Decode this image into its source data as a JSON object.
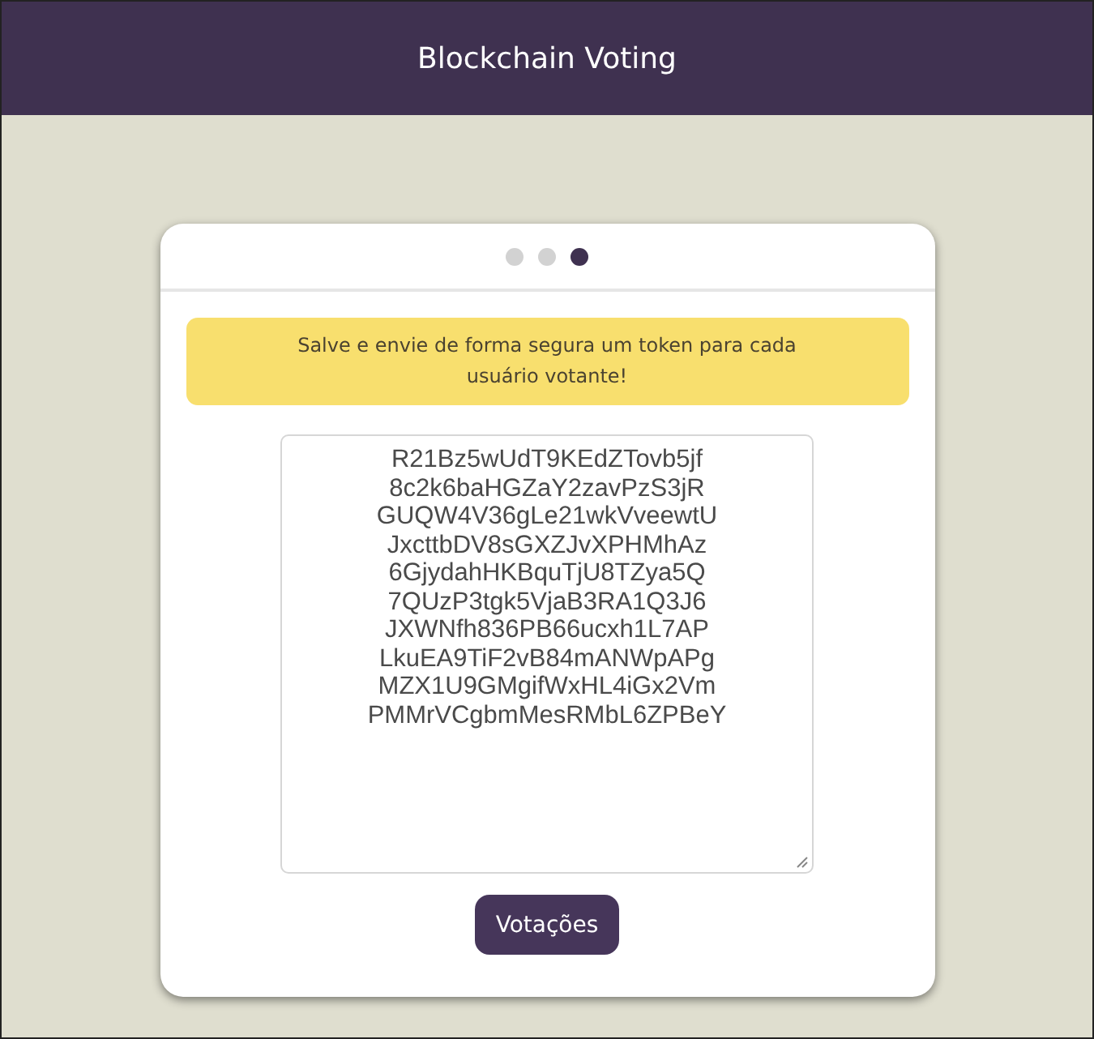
{
  "header": {
    "title": "Blockchain Voting"
  },
  "steps": [
    {
      "selected": false
    },
    {
      "selected": false
    },
    {
      "selected": true
    }
  ],
  "alert": "Salve e envie de forma segura um token para cada usuário votante!",
  "tokens": [
    "R21Bz5wUdT9KEdZTovb5jf",
    "8c2k6baHGZaY2zavPzS3jR",
    "GUQW4V36gLe21wkVveewtU",
    "JxcttbDV8sGXZJvXPHMhAz",
    "6GjydahHKBquTjU8TZya5Q",
    "7QUzP3tgk5VjaB3RA1Q3J6",
    "JXWNfh836PB66ucxh1L7AP",
    "LkuEA9TiF2vB84mANWpAPg",
    "MZX1U9GMgifWxHL4iGx2Vm",
    "PMMrVCgbmMesRMbL6ZPBeY"
  ],
  "button": "Votações"
}
